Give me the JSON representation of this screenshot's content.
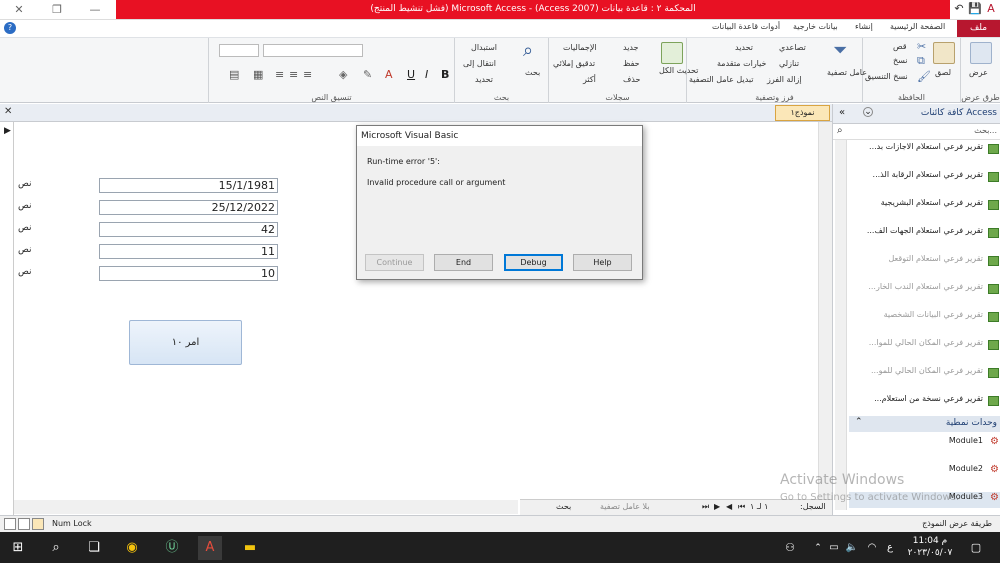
{
  "titlebar": {
    "title": "المحكمة ٢ : قاعدة بيانات (Access 2007) - Microsoft Access (فشل تنشيط المنتج)"
  },
  "ribbon_tabs": {
    "file": "ملف",
    "home": "الصفحة الرئيسية",
    "create": "إنشاء",
    "external": "بيانات خارجية",
    "dbtools": "أدوات قاعدة البيانات"
  },
  "ribbon": {
    "views_group": "طرق عرض",
    "view_btn": "عرض",
    "clipboard_group": "الحافظة",
    "paste_btn": "لصق",
    "cut": "قص",
    "copy": "نسخ",
    "format_painter": "نسخ التنسيق",
    "sort_group": "فرز وتصفية",
    "filter_btn": "عامل تصفية",
    "ascending": "تصاعدي",
    "descending": "تنازلي",
    "remove_sort": "إزالة الفرز",
    "selection": "تحديد",
    "advanced": "خيارات متقدمة",
    "toggle_filter": "تبديل عامل التصفية",
    "records_group": "سجلات",
    "refresh_all": "تحديث الكل",
    "new": "جديد",
    "save": "حفظ",
    "delete": "حذف",
    "totals": "الإجماليات",
    "spelling": "تدقيق إملائي",
    "more": "أكثر",
    "find_group": "بحث",
    "find_btn": "بحث",
    "replace": "استبدال",
    "goto": "انتقال إلى",
    "select": "تحديد",
    "text_group": "تنسيق النص"
  },
  "navpane": {
    "title": "كافة كائنات Access",
    "search_placeholder": "بحث...",
    "reports": [
      "تقرير فرعي استعلام الاجازات بد...",
      "تقرير فرعي استعلام الرقابة الذ...",
      "تقرير فرعي استعلام البشريجية",
      "تقرير فرعي استعلام الجهات الف...",
      "تقرير فرعي استعلام التوقعل",
      "تقرير فرعي استعلام الندب الخار...",
      "تقرير فرعي البيانات الشخصية",
      "تقرير فرعي المكان الحالي للموا...",
      "تقرير فرعي المكان الحالي للمو...",
      "تقرير فرعي نسخة من استعلام..."
    ],
    "modules_section": "وحدات نمطية",
    "modules": [
      "Module1",
      "Module2",
      "Module3"
    ]
  },
  "document": {
    "tab_label": "نموذج١",
    "fields": [
      {
        "label": "نص",
        "value": "15/1/1981"
      },
      {
        "label": "نص",
        "value": "25/12/2022"
      },
      {
        "label": "نص",
        "value": "42"
      },
      {
        "label": "نص",
        "value": "11"
      },
      {
        "label": "نص",
        "value": "10"
      }
    ],
    "command_button": "امر ١٠"
  },
  "recnav": {
    "label": "السجل:",
    "position": "١ لـ ١",
    "filter": "بلا عامل تصفية",
    "search": "بحث"
  },
  "statusbar": {
    "left": "Num Lock",
    "right": "طريقة عرض النموذج"
  },
  "watermark": {
    "line1": "Activate Windows",
    "line2": "Go to Settings to activate Windows."
  },
  "dialog": {
    "title": "Microsoft Visual Basic",
    "line1": "Run-time error '5':",
    "line2": "Invalid procedure call or argument",
    "btn_continue": "Continue",
    "btn_end": "End",
    "btn_debug": "Debug",
    "btn_help": "Help"
  },
  "taskbar": {
    "time": "11:04 م",
    "date": "٢٠٢٣/٠٥/٠٧",
    "lang": "ع"
  }
}
